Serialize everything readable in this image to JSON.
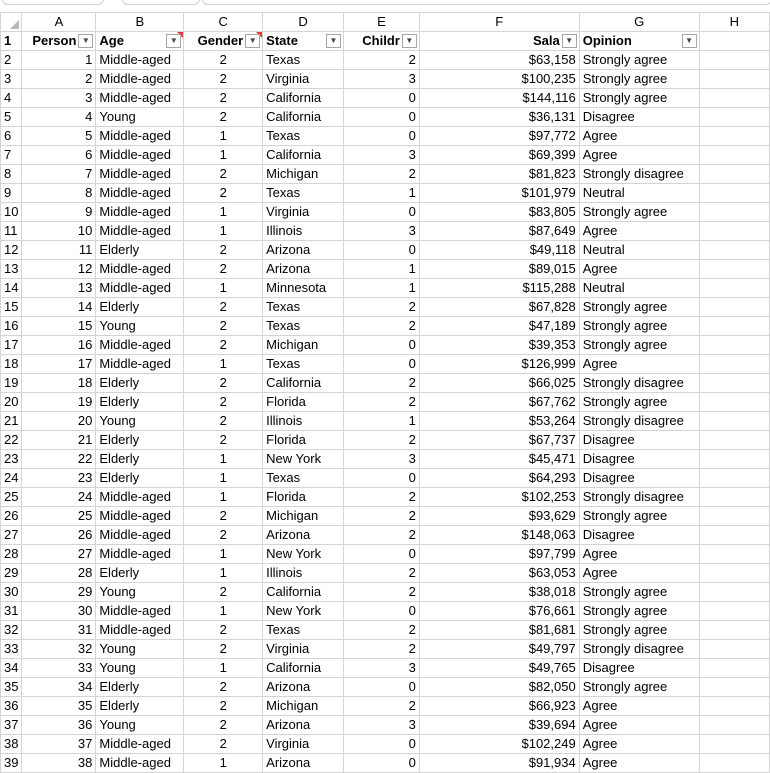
{
  "columns": [
    "A",
    "B",
    "C",
    "D",
    "E",
    "F",
    "G",
    "H"
  ],
  "header": {
    "person": "Person",
    "age": "Age",
    "gender": "Gender",
    "state": "State",
    "children": "Childr",
    "salary": "Sala",
    "opinion": "Opinion"
  },
  "filter_icon": "chevron-down-icon",
  "rows": [
    {
      "n": "2",
      "person": "1",
      "age": "Middle-aged",
      "gender": "2",
      "state": "Texas",
      "children": "2",
      "salary": "$63,158",
      "opinion": "Strongly agree"
    },
    {
      "n": "3",
      "person": "2",
      "age": "Middle-aged",
      "gender": "2",
      "state": "Virginia",
      "children": "3",
      "salary": "$100,235",
      "opinion": "Strongly agree"
    },
    {
      "n": "4",
      "person": "3",
      "age": "Middle-aged",
      "gender": "2",
      "state": "California",
      "children": "0",
      "salary": "$144,116",
      "opinion": "Strongly agree"
    },
    {
      "n": "5",
      "person": "4",
      "age": "Young",
      "gender": "2",
      "state": "California",
      "children": "0",
      "salary": "$36,131",
      "opinion": "Disagree"
    },
    {
      "n": "6",
      "person": "5",
      "age": "Middle-aged",
      "gender": "1",
      "state": "Texas",
      "children": "0",
      "salary": "$97,772",
      "opinion": "Agree"
    },
    {
      "n": "7",
      "person": "6",
      "age": "Middle-aged",
      "gender": "1",
      "state": "California",
      "children": "3",
      "salary": "$69,399",
      "opinion": "Agree"
    },
    {
      "n": "8",
      "person": "7",
      "age": "Middle-aged",
      "gender": "2",
      "state": "Michigan",
      "children": "2",
      "salary": "$81,823",
      "opinion": "Strongly disagree"
    },
    {
      "n": "9",
      "person": "8",
      "age": "Middle-aged",
      "gender": "2",
      "state": "Texas",
      "children": "1",
      "salary": "$101,979",
      "opinion": "Neutral"
    },
    {
      "n": "10",
      "person": "9",
      "age": "Middle-aged",
      "gender": "1",
      "state": "Virginia",
      "children": "0",
      "salary": "$83,805",
      "opinion": "Strongly agree"
    },
    {
      "n": "11",
      "person": "10",
      "age": "Middle-aged",
      "gender": "1",
      "state": "Illinois",
      "children": "3",
      "salary": "$87,649",
      "opinion": "Agree"
    },
    {
      "n": "12",
      "person": "11",
      "age": "Elderly",
      "gender": "2",
      "state": "Arizona",
      "children": "0",
      "salary": "$49,118",
      "opinion": "Neutral"
    },
    {
      "n": "13",
      "person": "12",
      "age": "Middle-aged",
      "gender": "2",
      "state": "Arizona",
      "children": "1",
      "salary": "$89,015",
      "opinion": "Agree"
    },
    {
      "n": "14",
      "person": "13",
      "age": "Middle-aged",
      "gender": "1",
      "state": "Minnesota",
      "children": "1",
      "salary": "$115,288",
      "opinion": "Neutral"
    },
    {
      "n": "15",
      "person": "14",
      "age": "Elderly",
      "gender": "2",
      "state": "Texas",
      "children": "2",
      "salary": "$67,828",
      "opinion": "Strongly agree"
    },
    {
      "n": "16",
      "person": "15",
      "age": "Young",
      "gender": "2",
      "state": "Texas",
      "children": "2",
      "salary": "$47,189",
      "opinion": "Strongly agree"
    },
    {
      "n": "17",
      "person": "16",
      "age": "Middle-aged",
      "gender": "2",
      "state": "Michigan",
      "children": "0",
      "salary": "$39,353",
      "opinion": "Strongly agree"
    },
    {
      "n": "18",
      "person": "17",
      "age": "Middle-aged",
      "gender": "1",
      "state": "Texas",
      "children": "0",
      "salary": "$126,999",
      "opinion": "Agree"
    },
    {
      "n": "19",
      "person": "18",
      "age": "Elderly",
      "gender": "2",
      "state": "California",
      "children": "2",
      "salary": "$66,025",
      "opinion": "Strongly disagree"
    },
    {
      "n": "20",
      "person": "19",
      "age": "Elderly",
      "gender": "2",
      "state": "Florida",
      "children": "2",
      "salary": "$67,762",
      "opinion": "Strongly agree"
    },
    {
      "n": "21",
      "person": "20",
      "age": "Young",
      "gender": "2",
      "state": "Illinois",
      "children": "1",
      "salary": "$53,264",
      "opinion": "Strongly disagree"
    },
    {
      "n": "22",
      "person": "21",
      "age": "Elderly",
      "gender": "2",
      "state": "Florida",
      "children": "2",
      "salary": "$67,737",
      "opinion": "Disagree"
    },
    {
      "n": "23",
      "person": "22",
      "age": "Elderly",
      "gender": "1",
      "state": "New York",
      "children": "3",
      "salary": "$45,471",
      "opinion": "Disagree"
    },
    {
      "n": "24",
      "person": "23",
      "age": "Elderly",
      "gender": "1",
      "state": "Texas",
      "children": "0",
      "salary": "$64,293",
      "opinion": "Disagree"
    },
    {
      "n": "25",
      "person": "24",
      "age": "Middle-aged",
      "gender": "1",
      "state": "Florida",
      "children": "2",
      "salary": "$102,253",
      "opinion": "Strongly disagree"
    },
    {
      "n": "26",
      "person": "25",
      "age": "Middle-aged",
      "gender": "2",
      "state": "Michigan",
      "children": "2",
      "salary": "$93,629",
      "opinion": "Strongly agree"
    },
    {
      "n": "27",
      "person": "26",
      "age": "Middle-aged",
      "gender": "2",
      "state": "Arizona",
      "children": "2",
      "salary": "$148,063",
      "opinion": "Disagree"
    },
    {
      "n": "28",
      "person": "27",
      "age": "Middle-aged",
      "gender": "1",
      "state": "New York",
      "children": "0",
      "salary": "$97,799",
      "opinion": "Agree"
    },
    {
      "n": "29",
      "person": "28",
      "age": "Elderly",
      "gender": "1",
      "state": "Illinois",
      "children": "2",
      "salary": "$63,053",
      "opinion": "Agree"
    },
    {
      "n": "30",
      "person": "29",
      "age": "Young",
      "gender": "2",
      "state": "California",
      "children": "2",
      "salary": "$38,018",
      "opinion": "Strongly agree"
    },
    {
      "n": "31",
      "person": "30",
      "age": "Middle-aged",
      "gender": "1",
      "state": "New York",
      "children": "0",
      "salary": "$76,661",
      "opinion": "Strongly agree"
    },
    {
      "n": "32",
      "person": "31",
      "age": "Middle-aged",
      "gender": "2",
      "state": "Texas",
      "children": "2",
      "salary": "$81,681",
      "opinion": "Strongly agree"
    },
    {
      "n": "33",
      "person": "32",
      "age": "Young",
      "gender": "2",
      "state": "Virginia",
      "children": "2",
      "salary": "$49,797",
      "opinion": "Strongly disagree"
    },
    {
      "n": "34",
      "person": "33",
      "age": "Young",
      "gender": "1",
      "state": "California",
      "children": "3",
      "salary": "$49,765",
      "opinion": "Disagree"
    },
    {
      "n": "35",
      "person": "34",
      "age": "Elderly",
      "gender": "2",
      "state": "Arizona",
      "children": "0",
      "salary": "$82,050",
      "opinion": "Strongly agree"
    },
    {
      "n": "36",
      "person": "35",
      "age": "Elderly",
      "gender": "2",
      "state": "Michigan",
      "children": "2",
      "salary": "$66,923",
      "opinion": "Agree"
    },
    {
      "n": "37",
      "person": "36",
      "age": "Young",
      "gender": "2",
      "state": "Arizona",
      "children": "3",
      "salary": "$39,694",
      "opinion": "Agree"
    },
    {
      "n": "38",
      "person": "37",
      "age": "Middle-aged",
      "gender": "2",
      "state": "Virginia",
      "children": "0",
      "salary": "$102,249",
      "opinion": "Agree"
    },
    {
      "n": "39",
      "person": "38",
      "age": "Middle-aged",
      "gender": "1",
      "state": "Arizona",
      "children": "0",
      "salary": "$91,934",
      "opinion": "Agree"
    }
  ]
}
